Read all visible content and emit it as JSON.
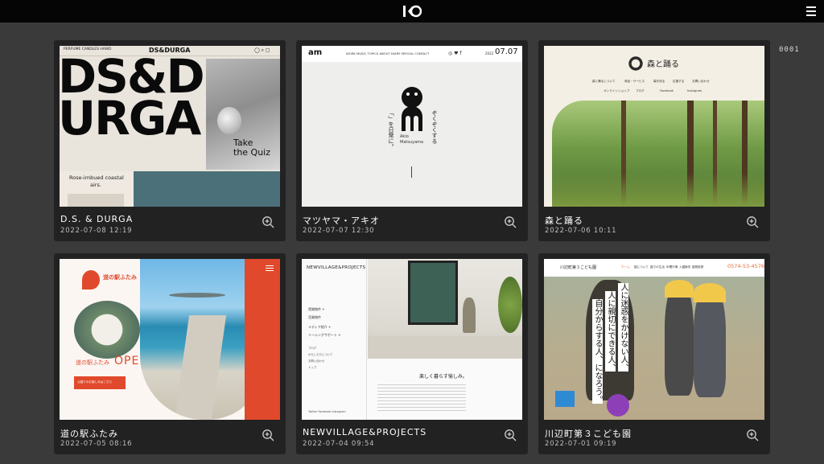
{
  "header": {
    "logo_icon": "ko-logo-icon",
    "menu_icon": "hamburger-menu-icon"
  },
  "counter": "0001",
  "cards": [
    {
      "title": "D.S. & DURGA",
      "date": "2022-07-08 12:19",
      "thumb": {
        "nav_left": "PERFUME  CANDLES  HAIKO",
        "brand": "DS&DURGA",
        "hero_line1": "DS&D",
        "hero_line2": "URGA",
        "quiz_line1": "Take",
        "quiz_line2": "the Quiz",
        "tagline_line1": "Rose-imbued coastal",
        "tagline_line2": "airs."
      }
    },
    {
      "title": "マツヤマ・アキオ",
      "date": "2022-07-07 12:30",
      "thumb": {
        "logo": "am",
        "nav": "WORK  MUSIC  TOPICS  ABOUT  DIARY  SPECIAL  CONTACT",
        "date_small": "2022",
        "date_big": "07.07",
        "vertical_1": "ぞくぞくする",
        "vertical_2": "「」を日常に。",
        "name_line1": "Akio",
        "name_line2": "Matsuyama"
      }
    },
    {
      "title": "森と踊る",
      "date": "2022-07-06 10:11",
      "thumb": {
        "brand": "森と踊る",
        "nav": [
          "森と踊るについて",
          "商品・サービス",
          "森を知る",
          "応援する",
          "お問い合わせ"
        ],
        "links": [
          "オンラインショップ",
          "ブログ",
          "Facebook",
          "Instagram"
        ]
      }
    },
    {
      "title": "道の駅ふたみ",
      "date": "2022-07-05 08:16",
      "thumb": {
        "brand": "道の駅ふたみ",
        "headline_jp": "道の駅ふたみ",
        "headline_en": "OPEN",
        "button": "公園でのお楽しみはこちら"
      }
    },
    {
      "title": "NEWVILLAGE&PROJECTS",
      "date": "2022-07-04 09:54",
      "thumb": {
        "brand": "NEWVILLAGE&PROJECTS",
        "menu": [
          "賃貸物件 +",
          "売買物件",
          "メディア紹介 +",
          "リーシングサポート +"
        ],
        "menu_small": [
          "ブログ",
          "わたしたちについて",
          "お問い合わせ",
          "トップ"
        ],
        "caption": "楽しく暮らす愉しみ。",
        "footer": "Twitter  Facebook  Instagram"
      }
    },
    {
      "title": "川辺町第３こども園",
      "date": "2022-07-01 09:19",
      "thumb": {
        "brand": "川辺町第３こども園",
        "phone": "0574-53-4576",
        "nav": [
          "ホーム",
          "園について",
          "園での生活",
          "年間行事",
          "入園案内",
          "園長挨拶"
        ],
        "copy_1": "人に迷惑をかけない人、",
        "copy_2": "人に親切にできる人、",
        "copy_3": "自分からする人、になろう。"
      }
    }
  ]
}
